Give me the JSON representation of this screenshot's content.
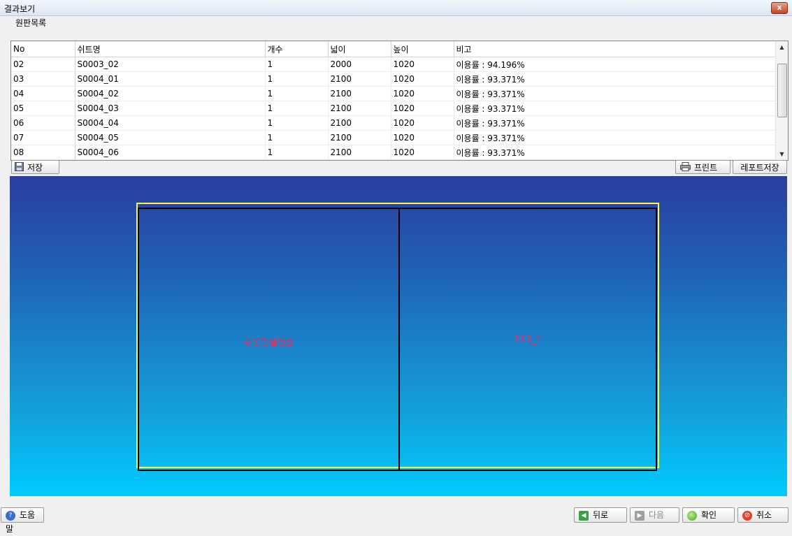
{
  "window": {
    "title": "결과보기",
    "close_label": "x"
  },
  "group": {
    "label": "원판목록"
  },
  "table": {
    "headers": [
      "No",
      "쉬트명",
      "개수",
      "넓이",
      "높이",
      "비고"
    ],
    "rows": [
      [
        "02",
        "S0003_02",
        "1",
        "2000",
        "1020",
        "이용률 : 94.196%"
      ],
      [
        "03",
        "S0004_01",
        "1",
        "2100",
        "1020",
        "이용률 : 93.371%"
      ],
      [
        "04",
        "S0004_02",
        "1",
        "2100",
        "1020",
        "이용률 : 93.371%"
      ],
      [
        "05",
        "S0004_03",
        "1",
        "2100",
        "1020",
        "이용률 : 93.371%"
      ],
      [
        "06",
        "S0004_04",
        "1",
        "2100",
        "1020",
        "이용률 : 93.371%"
      ],
      [
        "07",
        "S0004_05",
        "1",
        "2100",
        "1020",
        "이용률 : 93.371%"
      ],
      [
        "08",
        "S0004_06",
        "1",
        "2100",
        "1020",
        "이용률 : 93.371%"
      ]
    ]
  },
  "toolbar": {
    "save_label": "저장",
    "print_label": "프린트",
    "report_save_label": "레포트저장"
  },
  "canvas": {
    "panels": [
      {
        "label": "수동판넬연습"
      },
      {
        "label": "2X3_1"
      }
    ]
  },
  "footer": {
    "help_label": "도움말",
    "back_label": "뒤로",
    "next_label": "다음",
    "confirm_label": "확인",
    "cancel_label": "취소"
  },
  "colors": {
    "accent_yellow": "#ffff33",
    "panel_label": "#dd3366"
  }
}
